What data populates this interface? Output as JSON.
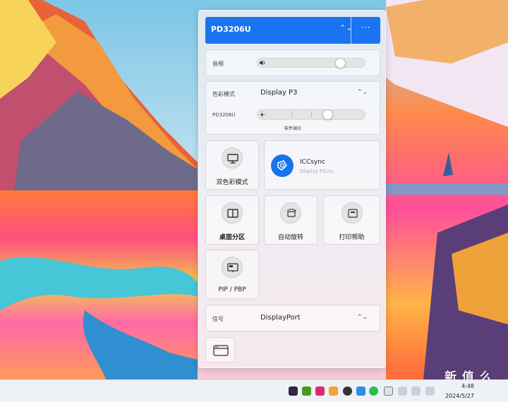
{
  "panel": {
    "title": "PD3206U",
    "sort_icon": "⌃⌄",
    "more_label": "···",
    "volume": {
      "label": "音频",
      "level": 0.79
    },
    "color_mode": {
      "label": "色彩模式",
      "value": "Display P3",
      "sort_icon": "⌃⌄"
    },
    "brightness": {
      "label": "PD3206U",
      "level": 0.66,
      "caption": "软件调光"
    },
    "tiles": [
      {
        "label": "双色彩模式",
        "icon": "monitor-icon"
      },
      {
        "label": "ICCsync",
        "sub": "Display P3.icc",
        "icon": "iccsync-icon"
      },
      {
        "label": "桌面分区",
        "icon": "split-screen-icon"
      },
      {
        "label": "自动旋转",
        "icon": "rotate-icon"
      },
      {
        "label": "打印帮助",
        "icon": "print-help-icon"
      },
      {
        "label": "PIP / PBP",
        "icon": "pip-icon"
      }
    ],
    "signal": {
      "label": "信号",
      "value": "DisplayPort",
      "sort_icon": "⌃⌄"
    }
  },
  "taskbar": {
    "time": "4:48",
    "date": "2024/5/27"
  },
  "watermark": "新 值 么 值 得 买",
  "colors": {
    "accent": "#1a73f0",
    "iccsync": "#1a73e8"
  }
}
